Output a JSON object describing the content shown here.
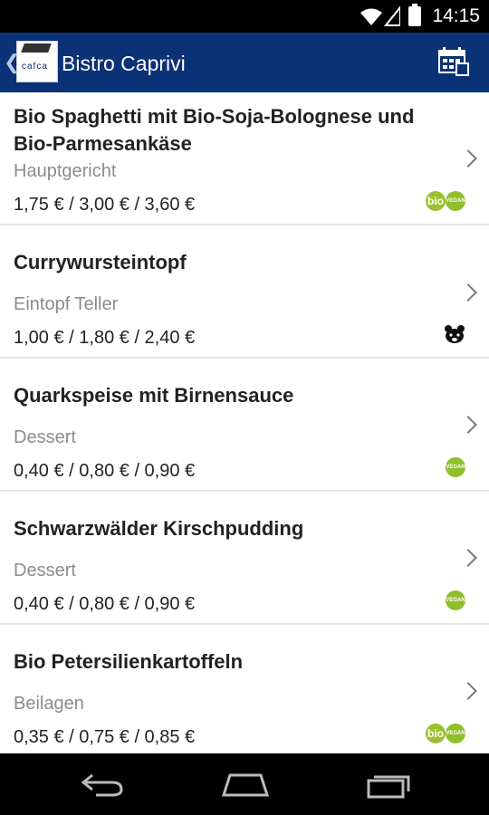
{
  "status_bar": {
    "time": "14:15"
  },
  "action_bar": {
    "title": "Bistro Caprivi",
    "logo_text": "cafca"
  },
  "menu_items": [
    {
      "name": "Bio Spaghetti mit Bio-Soja-Bolognese und Bio-Parmesankäse",
      "category": "Hauptgericht",
      "price": "1,75 € / 3,00 € / 3,60 €",
      "badges": [
        "bio",
        "vegan"
      ]
    },
    {
      "name": "Currywursteintopf",
      "category": "Eintopf Teller",
      "price": "1,00 € / 1,80 € / 2,40 €",
      "badges": [
        "pig"
      ]
    },
    {
      "name": "Quarkspeise mit Birnensauce",
      "category": "Dessert",
      "price": "0,40 € / 0,80 € / 0,90 €",
      "badges": [
        "vegan"
      ]
    },
    {
      "name": "Schwarzwälder Kirschpudding",
      "category": "Dessert",
      "price": "0,40 € / 0,80 € / 0,90 €",
      "badges": [
        "vegan"
      ]
    },
    {
      "name": "Bio Petersilienkartoffeln",
      "category": "Beilagen",
      "price": "0,35 € / 0,75 € / 0,85 €",
      "badges": [
        "bio",
        "vegan"
      ]
    }
  ],
  "badge_labels": {
    "bio": "bio",
    "vegan": "VEGAN"
  },
  "colors": {
    "action_bar": "#0b3177",
    "bio_green": "#9bc22e",
    "vegan_green": "#8fbf2a"
  }
}
